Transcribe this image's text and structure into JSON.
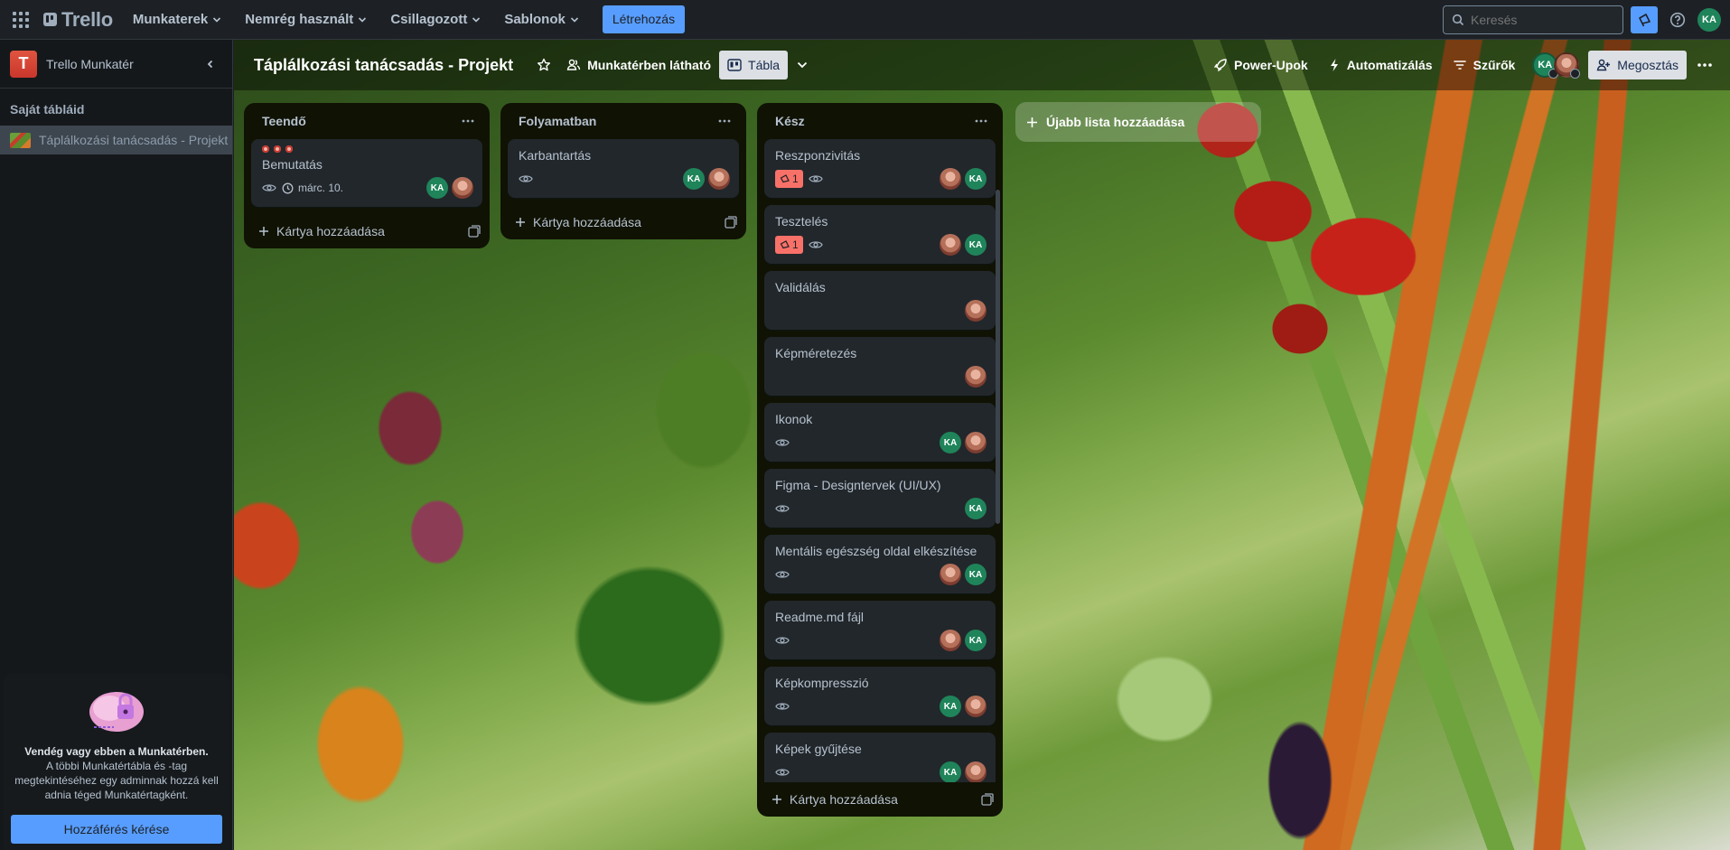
{
  "topnav": {
    "app_name": "Trello",
    "menus": [
      {
        "label": "Munkaterek"
      },
      {
        "label": "Nemrég használt"
      },
      {
        "label": "Csillagozott"
      },
      {
        "label": "Sablonok"
      }
    ],
    "create_label": "Létrehozás",
    "search_placeholder": "Keresés",
    "user_initials": "KA"
  },
  "sidebar": {
    "workspace_initial": "T",
    "workspace_name": "Trello Munkatér",
    "section_title": "Saját tábláid",
    "board_name": "Táplálkozási tanácsadás - Projekt",
    "guest": {
      "title": "Vendég vagy ebben a Munkatérben.",
      "text": "A többi Munkatértábla és -tag megtekintéséhez egy adminnak hozzá kell adnia téged Munkatértagként.",
      "button": "Hozzáférés kérése"
    }
  },
  "board": {
    "title": "Táplálkozási tanácsadás - Projekt",
    "visibility": "Munkatérben látható",
    "view": "Tábla",
    "powerups": "Power-Upok",
    "automation": "Automatizálás",
    "filters": "Szűrők",
    "share": "Megosztás",
    "member_initials": "KA",
    "add_list": "Újabb lista hozzáadása",
    "add_card": "Kártya hozzáadása",
    "lists": [
      {
        "title": "Teendő",
        "cards": [
          {
            "title": "Bemutatás",
            "date": "márc. 10."
          }
        ]
      },
      {
        "title": "Folyamatban",
        "cards": [
          {
            "title": "Karbantartás"
          }
        ]
      },
      {
        "title": "Kész",
        "cards": [
          {
            "title": "Reszponzivitás",
            "badge": "1"
          },
          {
            "title": "Tesztelés",
            "badge": "1"
          },
          {
            "title": "Validálás"
          },
          {
            "title": "Képméretezés"
          },
          {
            "title": "Ikonok"
          },
          {
            "title": "Figma - Designtervek (UI/UX)"
          },
          {
            "title": "Mentális egészség oldal elkészítése"
          },
          {
            "title": "Readme.md fájl"
          },
          {
            "title": "Képkompresszió"
          },
          {
            "title": "Képek gyűjtése"
          }
        ]
      }
    ]
  },
  "colors": {
    "accent": "#579dff",
    "list_bg": "#101204",
    "card_bg": "#22272b",
    "badge_red": "#f87168",
    "avatar_green": "#1f845a"
  }
}
